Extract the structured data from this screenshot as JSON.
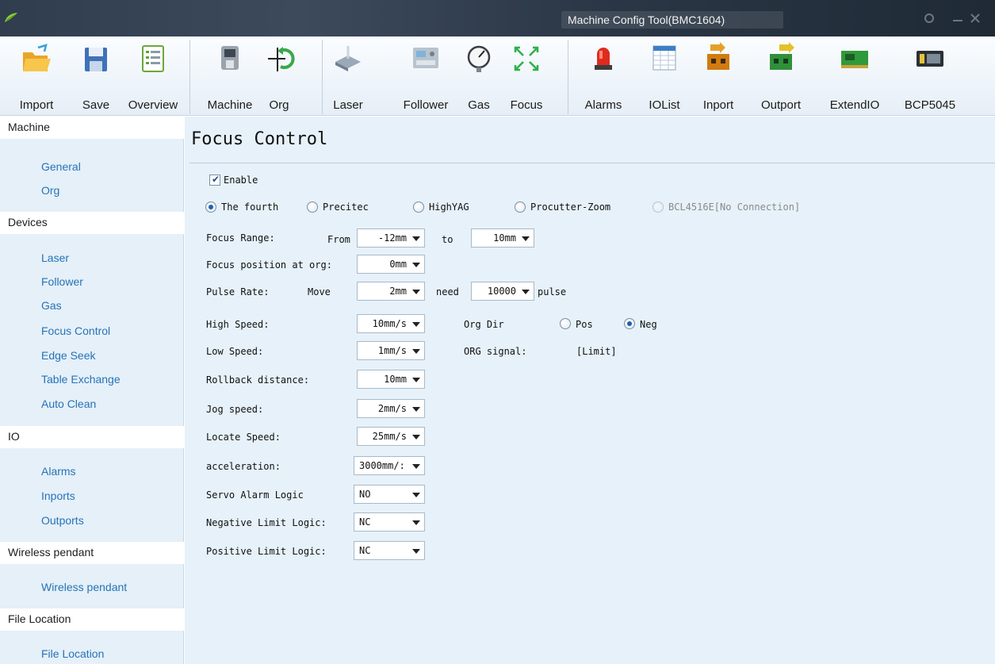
{
  "window": {
    "title": "Machine Config Tool(BMC1604)"
  },
  "toolbar": {
    "import": "Import",
    "save": "Save",
    "overview": "Overview",
    "machine": "Machine",
    "org": "Org",
    "laser": "Laser",
    "follower": "Follower",
    "gas": "Gas",
    "focus": "Focus",
    "alarms": "Alarms",
    "iolist": "IOList",
    "inport": "Inport",
    "outport": "Outport",
    "extendio": "ExtendIO",
    "bcp5045": "BCP5045"
  },
  "sidebar": {
    "machine": {
      "header": "Machine",
      "items": [
        "General",
        "Org"
      ]
    },
    "devices": {
      "header": "Devices",
      "items": [
        "Laser",
        "Follower",
        "Gas",
        "Focus Control",
        "Edge Seek",
        "Table Exchange",
        "Auto Clean"
      ]
    },
    "io": {
      "header": "IO",
      "items": [
        "Alarms",
        "Inports",
        "Outports"
      ]
    },
    "wireless": {
      "header": "Wireless pendant",
      "items": [
        "Wireless pendant"
      ]
    },
    "file": {
      "header": "File Location",
      "items": [
        "File Location"
      ]
    }
  },
  "page": {
    "title": "Focus Control",
    "enable": {
      "label": "Enable",
      "checked": true
    },
    "device_options": [
      {
        "label": "The fourth",
        "selected": true,
        "enabled": true
      },
      {
        "label": "Precitec",
        "selected": false,
        "enabled": true
      },
      {
        "label": "HighYAG",
        "selected": false,
        "enabled": true
      },
      {
        "label": "Procutter-Zoom",
        "selected": false,
        "enabled": true
      },
      {
        "label": "BCL4516E[No Connection]",
        "selected": false,
        "enabled": false
      }
    ],
    "focus_range": {
      "label": "Focus Range:",
      "from_label": "From",
      "from": "-12mm",
      "to_label": "to",
      "to": "10mm"
    },
    "focus_pos_org": {
      "label": "Focus position at org:",
      "value": "0mm"
    },
    "pulse_rate": {
      "label": "Pulse Rate:",
      "move_label": "Move",
      "move": "2mm",
      "need_label": "need",
      "need": "10000",
      "unit": "pulse"
    },
    "high_speed": {
      "label": "High Speed:",
      "value": "10mm/s"
    },
    "org_dir": {
      "label": "Org Dir",
      "pos": "Pos",
      "neg": "Neg",
      "selected": "Neg"
    },
    "low_speed": {
      "label": "Low Speed:",
      "value": "1mm/s"
    },
    "org_signal": {
      "label": "ORG signal:",
      "value": "[Limit]"
    },
    "rollback": {
      "label": "Rollback distance:",
      "value": "10mm"
    },
    "jog_speed": {
      "label": "Jog speed:",
      "value": "2mm/s"
    },
    "locate_speed": {
      "label": "Locate Speed:",
      "value": "25mm/s"
    },
    "acceleration": {
      "label": "acceleration:",
      "value": "3000mm/:"
    },
    "servo_alarm": {
      "label": "Servo Alarm Logic",
      "value": "NO"
    },
    "neg_limit": {
      "label": "Negative Limit Logic:",
      "value": "NC"
    },
    "pos_limit": {
      "label": "Positive Limit Logic:",
      "value": "NC"
    }
  },
  "colors": {
    "link": "#2673b8",
    "sidebar_bg": "#e5f0f8",
    "main_bg": "#e6f1f9",
    "titlebar": "#2f3d4e"
  }
}
